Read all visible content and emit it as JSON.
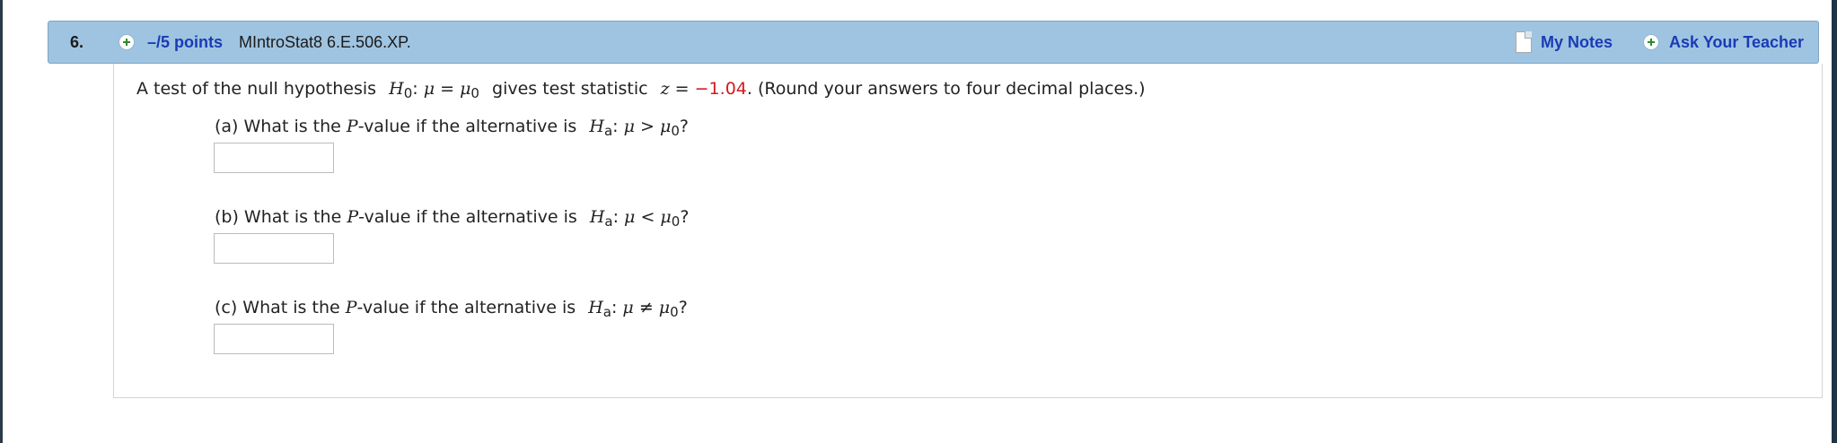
{
  "question": {
    "number": "6.",
    "points": "–/5 points",
    "code": "MIntroStat8 6.E.506.XP.",
    "my_notes": "My Notes",
    "ask_teacher": "Ask Your Teacher"
  },
  "statement": {
    "prefix": "A test of the null hypothesis",
    "h0_H": "H",
    "h0_sub": "0",
    "h0_colon": ":",
    "h0_mu": "μ",
    "h0_eq": "=",
    "h0_mu0": "μ",
    "h0_mu0_sub": "0",
    "mid": "gives test statistic",
    "z": "z",
    "z_eq": "=",
    "z_value": "−1.04",
    "suffix": ". (Round your answers to four decimal places.)"
  },
  "parts": [
    {
      "label": "(a) What is the",
      "p": "P",
      "rest": "-value if the alternative is",
      "ha_H": "H",
      "ha_sub": "a",
      "colon": ":",
      "mu": "μ",
      "op": ">",
      "mu0": "μ",
      "mu0_sub": "0",
      "q": "?",
      "answer": ""
    },
    {
      "label": "(b) What is the",
      "p": "P",
      "rest": "-value if the alternative is",
      "ha_H": "H",
      "ha_sub": "a",
      "colon": ":",
      "mu": "μ",
      "op": "<",
      "mu0": "μ",
      "mu0_sub": "0",
      "q": "?",
      "answer": ""
    },
    {
      "label": "(c) What is the",
      "p": "P",
      "rest": "-value if the alternative is",
      "ha_H": "H",
      "ha_sub": "a",
      "colon": ":",
      "mu": "μ",
      "op": "≠",
      "mu0": "μ",
      "mu0_sub": "0",
      "q": "?",
      "answer": ""
    }
  ],
  "colors": {
    "header_bg": "#9fc4e1",
    "link": "#1a3bb5",
    "value_red": "#d4191d"
  },
  "icons": [
    "plus-circle-icon",
    "note-icon"
  ]
}
